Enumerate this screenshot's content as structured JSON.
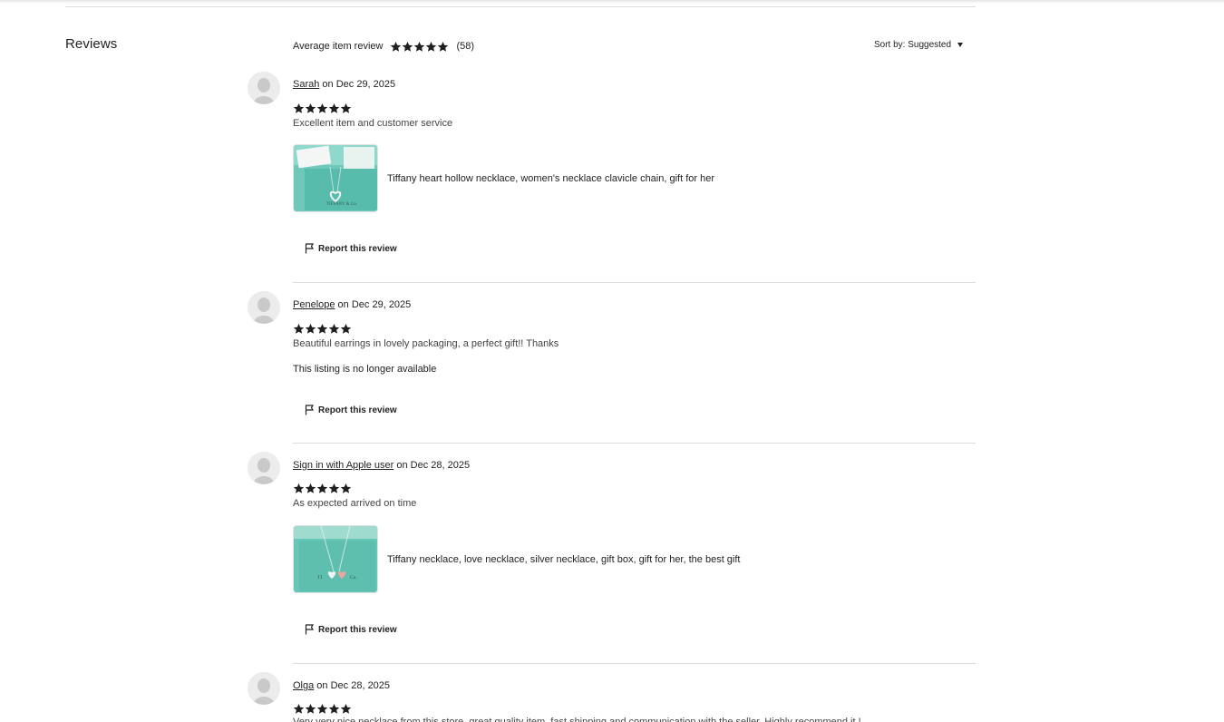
{
  "reviews_section": {
    "title": "Reviews",
    "average_label": "Average item review",
    "average_rating": 5,
    "total_count": "(58)",
    "sort_label": "Sort by: Suggested"
  },
  "reviews": [
    {
      "name": "Sarah",
      "date_text": " on Dec 29, 2025",
      "rating": 5,
      "text": "Excellent item and customer service",
      "item_title": "Tiffany heart hollow necklace, women's necklace clavicle chain, gift for her",
      "report_label": "Report this review"
    },
    {
      "name": "Penelope",
      "date_text": " on Dec 29, 2025",
      "rating": 5,
      "text": "Beautiful earrings in lovely packaging, a perfect gift!! Thanks",
      "unavailable_text": "This listing is no longer available",
      "report_label": "Report this review"
    },
    {
      "name": "Sign in with Apple user",
      "date_text": " on Dec 28, 2025",
      "rating": 5,
      "text": "As expected arrived on time",
      "item_title": "Tiffany necklace, love necklace, silver necklace, gift box, gift for her, the best gift",
      "report_label": "Report this review"
    },
    {
      "name": "Olga",
      "date_text": " on Dec 28, 2025",
      "rating": 5,
      "text": "Very very nice necklace from this store, great quality item, fast shipping and communication with the seller. Highly recommend it !"
    }
  ],
  "colors": {
    "star": "#1f1f1f",
    "divider": "#dcdcdc",
    "tiffany_blue": "#7fd1c3",
    "avatar_bg": "#ececec"
  },
  "icons": {
    "star": "star-icon",
    "flag": "flag-icon",
    "caret": "caret-down-icon",
    "avatar": "avatar-placeholder-icon"
  }
}
